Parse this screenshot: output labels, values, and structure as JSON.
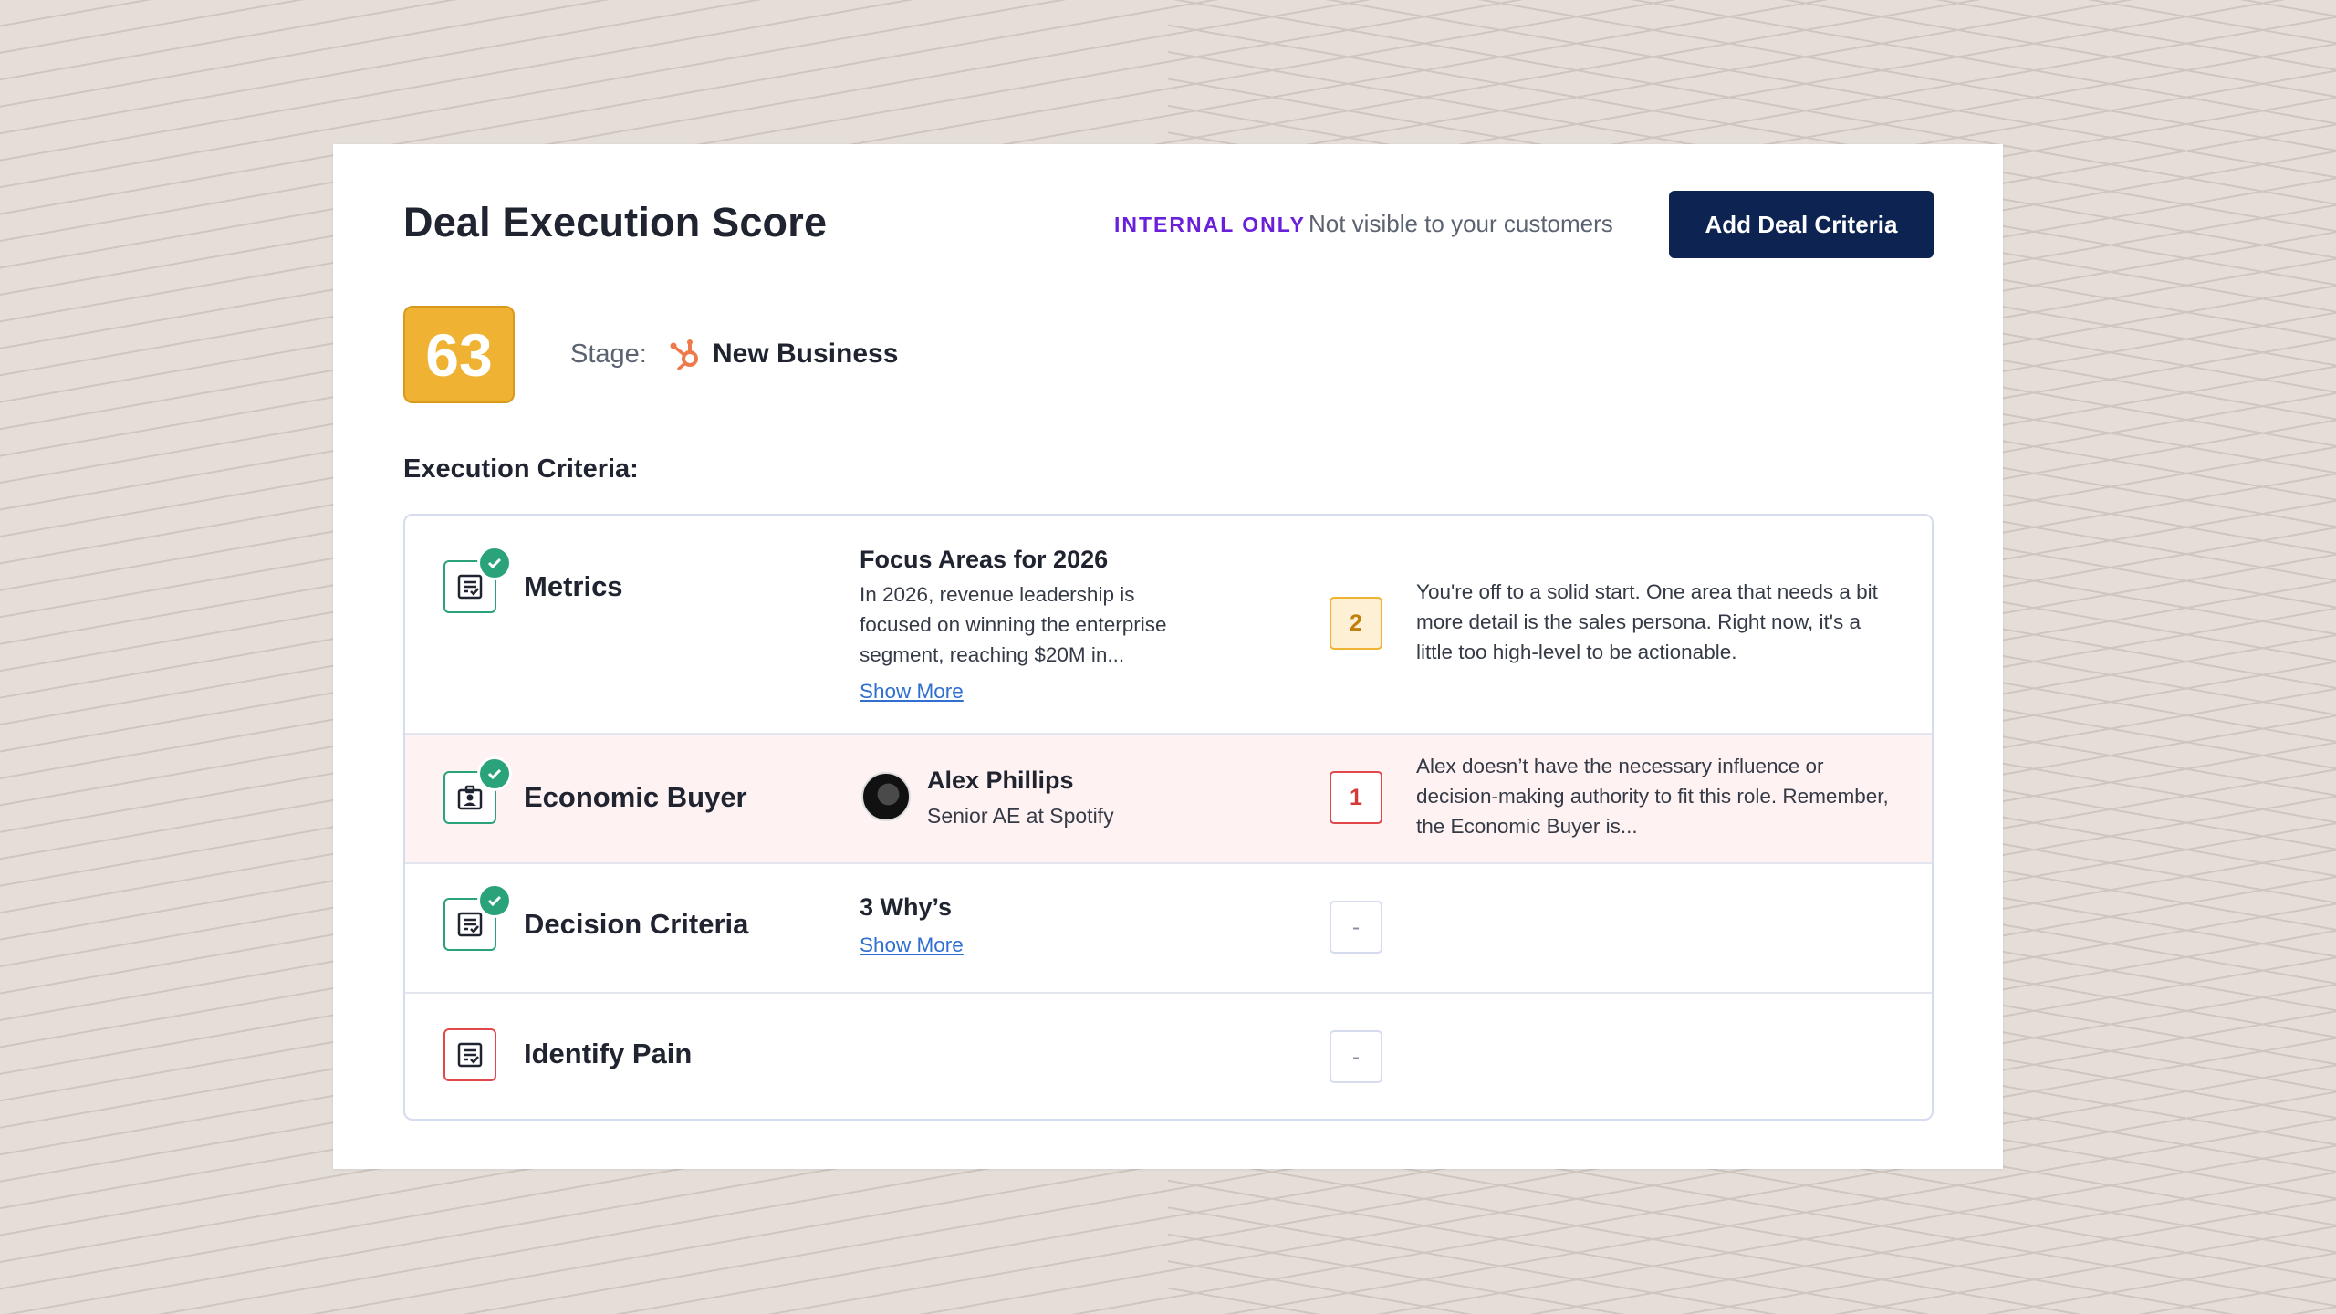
{
  "header": {
    "title": "Deal Execution Score",
    "internal_label": "INTERNAL ONLY",
    "internal_note": "Not visible to your customers",
    "add_button": "Add Deal Criteria"
  },
  "score": {
    "value": "63",
    "color": "#f0b232"
  },
  "stage": {
    "label": "Stage:",
    "icon": "hubspot-icon",
    "value": "New Business"
  },
  "execution_label": "Execution Criteria:",
  "criteria": [
    {
      "name": "Metrics",
      "icon": "document-check-icon",
      "completed": true,
      "detail_title": "Focus Areas for 2026",
      "detail_text": "In 2026, revenue leadership is focused on winning the enterprise segment, reaching $20M in...",
      "show_more": "Show More",
      "badge": "2",
      "badge_color": "#f0b232",
      "feedback": "You're off to a solid start. One area that needs a bit more detail is the sales persona. Right now, it's a little too high-level to be actionable."
    },
    {
      "name": "Economic Buyer",
      "icon": "id-badge-icon",
      "completed": true,
      "person_name": "Alex Phillips",
      "person_role": "Senior AE at Spotify",
      "badge": "1",
      "badge_color": "#e0484a",
      "feedback": "Alex doesn’t have the necessary influence or decision-making authority to fit this role. Remember, the Economic Buyer is..."
    },
    {
      "name": "Decision Criteria",
      "icon": "document-check-icon",
      "completed": true,
      "detail_title": "3 Why’s",
      "show_more": "Show More",
      "badge": "-"
    },
    {
      "name": "Identify Pain",
      "icon": "document-check-icon",
      "completed": false,
      "badge": "-"
    }
  ]
}
